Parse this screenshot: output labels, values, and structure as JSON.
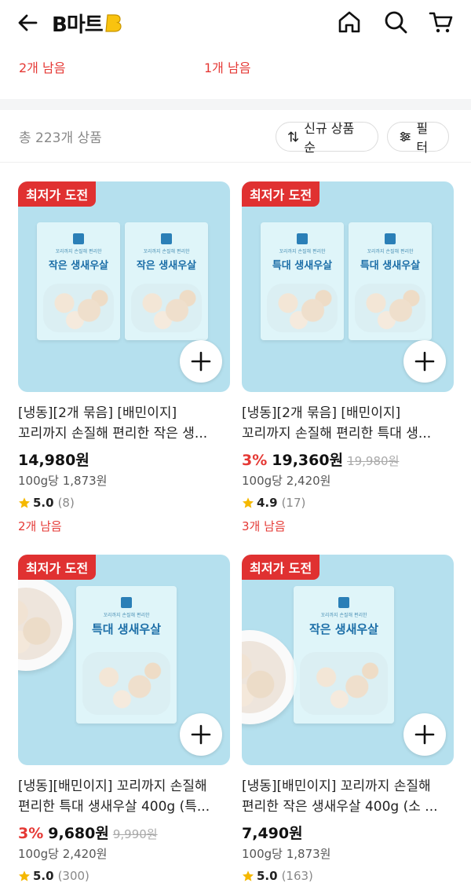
{
  "header": {
    "logo_text": "B마트"
  },
  "top_remaining": [
    "2개 남음",
    "1개 남음"
  ],
  "list": {
    "count_text": "총 223개 상품",
    "sort_label": "신규 상품 순",
    "filter_label": "필터"
  },
  "products": [
    {
      "badge": "최저가 도전",
      "pack_sub": "꼬리까지 손질해 편리한",
      "pack_name": "작은 생새우살",
      "title_line1": "[냉동][2개 묶음] [배민이지]",
      "title_line2": "꼬리까지 손질해 편리한 작은 생...",
      "discount": "",
      "price": "14,980원",
      "original_price": "",
      "unit_price": "100g당 1,873원",
      "rating": "5.0",
      "review_count": "(8)",
      "remaining": "2개 남음"
    },
    {
      "badge": "최저가 도전",
      "pack_sub": "꼬리까지 손질해 편리한",
      "pack_name": "특대 생새우살",
      "title_line1": "[냉동][2개 묶음] [배민이지]",
      "title_line2": "꼬리까지 손질해 편리한 특대 생...",
      "discount": "3%",
      "price": "19,360원",
      "original_price": "19,980원",
      "unit_price": "100g당 2,420원",
      "rating": "4.9",
      "review_count": "(17)",
      "remaining": "3개 남음"
    },
    {
      "badge": "최저가 도전",
      "pack_sub": "꼬리까지 손질해 편리한",
      "pack_name": "특대 생새우살",
      "title_line1": "[냉동][배민이지] 꼬리까지 손질해",
      "title_line2": "편리한 특대 생새우살 400g (특...",
      "discount": "3%",
      "price": "9,680원",
      "original_price": "9,990원",
      "unit_price": "100g당 2,420원",
      "rating": "5.0",
      "review_count": "(300)",
      "remaining": ""
    },
    {
      "badge": "최저가 도전",
      "pack_sub": "꼬리까지 손질해 편리한",
      "pack_name": "작은 생새우살",
      "title_line1": "[냉동][배민이지] 꼬리까지 손질해",
      "title_line2": "편리한 작은 생새우살 400g (소 ...",
      "discount": "",
      "price": "7,490원",
      "original_price": "",
      "unit_price": "100g당 1,873원",
      "rating": "5.0",
      "review_count": "(163)",
      "remaining": ""
    }
  ],
  "colors": {
    "accent_red": "#e53935",
    "badge_red": "#e03131",
    "star": "#f5b800",
    "image_bg": "#b5e0ee"
  }
}
